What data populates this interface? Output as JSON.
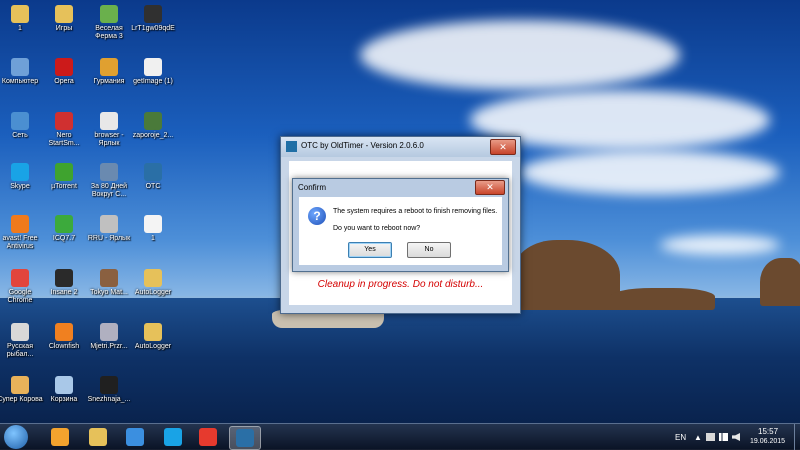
{
  "desktop": {
    "icons": [
      {
        "label": "1",
        "icon": "folder-icon",
        "color": "#e6c15a"
      },
      {
        "label": "Компьютер",
        "icon": "computer-icon",
        "color": "#6fa0d8"
      },
      {
        "label": "Сеть",
        "icon": "network-icon",
        "color": "#4b8fd1"
      },
      {
        "label": "Skype",
        "icon": "skype-icon",
        "color": "#19a3e6"
      },
      {
        "label": "avast! Free Antivirus",
        "icon": "avast-icon",
        "color": "#f07a1c"
      },
      {
        "label": "Google Chrome",
        "icon": "chrome-icon",
        "color": "#e2453c"
      },
      {
        "label": "Русская рыбал...",
        "icon": "fishing-game-icon",
        "color": "#d8d8d8"
      },
      {
        "label": "Супер Корова",
        "icon": "cow-game-icon",
        "color": "#e8b25a"
      },
      {
        "label": "Игры",
        "icon": "folder-icon",
        "color": "#e6c15a"
      },
      {
        "label": "Opera",
        "icon": "opera-icon",
        "color": "#cc1a1a"
      },
      {
        "label": "Nero StartSm...",
        "icon": "nero-icon",
        "color": "#d03030"
      },
      {
        "label": "µTorrent",
        "icon": "utorrent-icon",
        "color": "#3fa32f"
      },
      {
        "label": "ICQ7.7",
        "icon": "icq-icon",
        "color": "#3caa3c"
      },
      {
        "label": "Insane 2",
        "icon": "insane-game-icon",
        "color": "#2a2a2a"
      },
      {
        "label": "Clownfish",
        "icon": "clownfish-icon",
        "color": "#f08020"
      },
      {
        "label": "Корзина",
        "icon": "recycle-bin-icon",
        "color": "#a9c8e8"
      },
      {
        "label": "Веселая Ферма 3",
        "icon": "farm-game-icon",
        "color": "#6ab04c"
      },
      {
        "label": "Гурмания",
        "icon": "gourmania-icon",
        "color": "#e0a030"
      },
      {
        "label": "browser - Ярлык",
        "icon": "yandex-browser-icon",
        "color": "#e8e8e8"
      },
      {
        "label": "За 80 Дней Вокруг С...",
        "icon": "game-80-days-icon",
        "color": "#6a8ab0"
      },
      {
        "label": "RRU - Ярлык",
        "icon": "rru-icon",
        "color": "#c0c0c0"
      },
      {
        "label": "Tokyo Mat...",
        "icon": "tokyo-game-icon",
        "color": "#8a6040"
      },
      {
        "label": "Mjetri.Przr...",
        "icon": "file-icon",
        "color": "#b0b0c0"
      },
      {
        "label": "Snezhnaja_...",
        "icon": "video-file-icon",
        "color": "#202020"
      },
      {
        "label": "LrT1gw09qdE",
        "icon": "image-file-icon",
        "color": "#303030"
      },
      {
        "label": "getImage (1)",
        "icon": "image-file-icon",
        "color": "#f0f0f0"
      },
      {
        "label": "zaporoje_2...",
        "icon": "image-file-icon",
        "color": "#4a7a3a"
      },
      {
        "label": "OTC",
        "icon": "otc-icon",
        "color": "#2a6fa6"
      },
      {
        "label": "1",
        "icon": "document-icon",
        "color": "#f4f4f4"
      },
      {
        "label": "AutoLogger",
        "icon": "folder-icon",
        "color": "#e6c15a"
      },
      {
        "label": "AutoLogger",
        "icon": "folder-icon",
        "color": "#e6c15a"
      }
    ]
  },
  "otc_window": {
    "title": "OTC by OldTimer - Version 2.0.6.0",
    "close_label": "✕",
    "status": "Cleanup in progress. Do not disturb..."
  },
  "confirm_dialog": {
    "title": "Confirm",
    "close_label": "✕",
    "message_line1": "The system requires a reboot to finish removing files.",
    "message_line2": "Do you want to reboot now?",
    "icon": "question-icon",
    "yes_label": "Yes",
    "no_label": "No"
  },
  "taskbar": {
    "start_icon": "windows-start-icon",
    "pinned": [
      {
        "icon": "media-player-icon",
        "color": "#f3a32e"
      },
      {
        "icon": "file-explorer-icon",
        "color": "#e6c15a"
      },
      {
        "icon": "internet-explorer-icon",
        "color": "#3b8fe0"
      },
      {
        "icon": "skype-icon",
        "color": "#19a3e6"
      },
      {
        "icon": "yandex-browser-icon",
        "color": "#e63a2e"
      },
      {
        "icon": "otc-icon",
        "color": "#2a6fa6"
      }
    ],
    "language": "EN",
    "time": "15:57",
    "date": "19.06.2015"
  }
}
